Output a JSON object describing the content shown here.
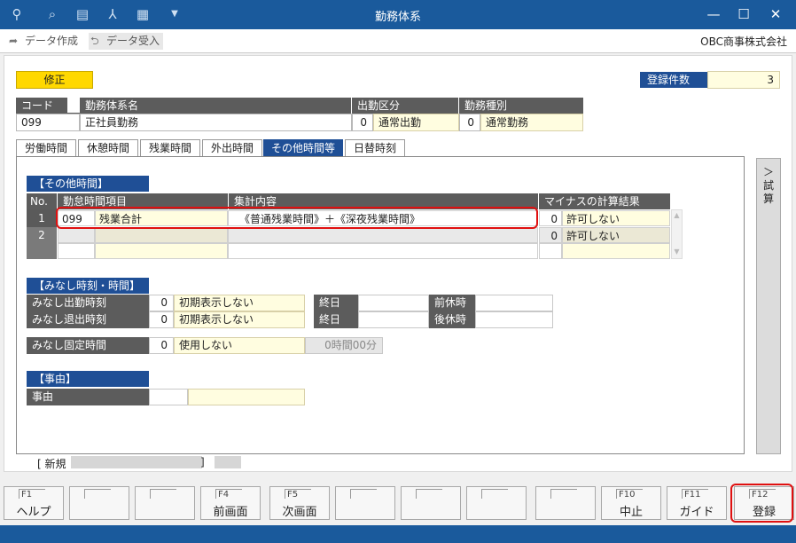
{
  "window": {
    "title": "勤務体系",
    "minimize": "—",
    "maximize": "☐",
    "close": "✕"
  },
  "toolbar": {
    "create_label": "データ作成",
    "receive_label": "データ受入",
    "company": "OBC商事株式会社"
  },
  "mode": "修正",
  "record_count": {
    "label": "登録件数",
    "value": "3"
  },
  "header_table": {
    "col_code": "コード",
    "col_name": "勤務体系名",
    "col_attendance": "出勤区分",
    "col_worktype": "勤務種別",
    "code": "099",
    "name": "正社員勤務",
    "attendance_code": "0",
    "attendance_name": "通常出勤",
    "worktype_code": "0",
    "worktype_name": "通常勤務"
  },
  "tabs": [
    {
      "label": "労働時間"
    },
    {
      "label": "休憩時間"
    },
    {
      "label": "残業時間"
    },
    {
      "label": "外出時間"
    },
    {
      "label": "その他時間等"
    },
    {
      "label": "日替時刻"
    }
  ],
  "other_time": {
    "title": "【その他時間】",
    "col_no": "No.",
    "col_item": "勤怠時間項目",
    "col_calc": "集計内容",
    "col_minus": "マイナスの計算結果",
    "rows": [
      {
        "no": "1",
        "code": "099",
        "item": "残業合計",
        "calc": "《普通残業時間》＋《深夜残業時間》",
        "minus_code": "0",
        "minus": "許可しない"
      },
      {
        "no": "2",
        "code": "",
        "item": "",
        "calc": "",
        "minus_code": "0",
        "minus": "許可しない"
      },
      {
        "no": "",
        "code": "",
        "item": "",
        "calc": "",
        "minus_code": "",
        "minus": ""
      }
    ]
  },
  "deemed": {
    "title": "【みなし時刻・時間】",
    "in_label": "みなし出勤時刻",
    "in_code": "0",
    "in_value": "初期表示しない",
    "out_label": "みなし退出時刻",
    "out_code": "0",
    "out_value": "初期表示しない",
    "end_day_label": "終日",
    "before_rest_label": "前休時",
    "after_rest_label": "後休時",
    "fixed_label": "みなし固定時間",
    "fixed_code": "0",
    "fixed_value": "使用しない",
    "fixed_time": "0時間00分"
  },
  "reason": {
    "title": "【事由】",
    "label": "事由"
  },
  "side_button": "＞試算",
  "status": {
    "prefix": "[ 新規",
    "suffix": "]"
  },
  "fkeys": [
    {
      "key": "F1",
      "label": "ヘルプ"
    },
    {
      "key": "",
      "label": ""
    },
    {
      "key": "",
      "label": ""
    },
    {
      "key": "F4",
      "label": "前画面"
    },
    {
      "key": "F5",
      "label": "次画面"
    },
    {
      "key": "",
      "label": ""
    },
    {
      "key": "",
      "label": ""
    },
    {
      "key": "",
      "label": ""
    },
    {
      "key": "",
      "label": ""
    },
    {
      "key": "F10",
      "label": "中止"
    },
    {
      "key": "F11",
      "label": "ガイド"
    },
    {
      "key": "F12",
      "label": "登録"
    }
  ],
  "colors": {
    "title_bar": "#1a5a9c",
    "tab_active": "#1f4f96",
    "mode_badge": "#ffd800",
    "highlight": "#e01010"
  }
}
